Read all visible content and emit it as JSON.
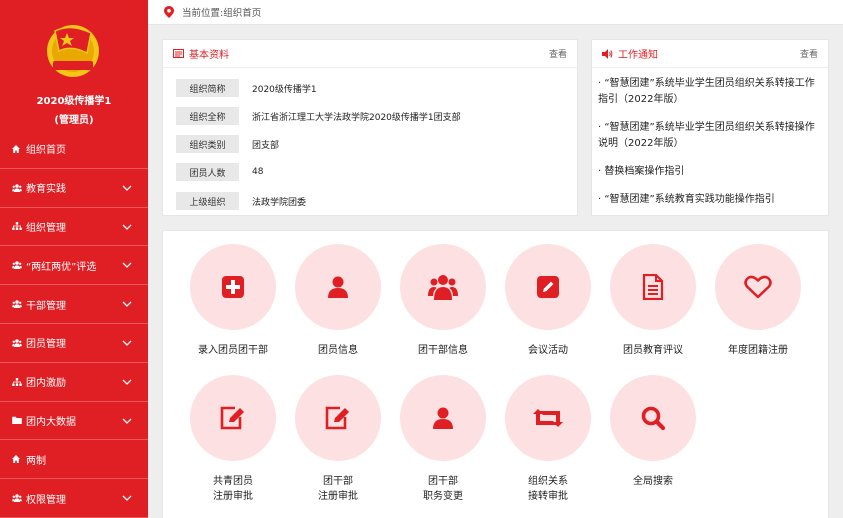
{
  "colors": {
    "brand_red": "#e01f25",
    "icon_bg": "#fde0e1"
  },
  "sidebar": {
    "org_name": "2020级传播学1",
    "role": "(管理员)",
    "items": [
      {
        "label": "组织首页",
        "icon": "home-icon",
        "has_chevron": false
      },
      {
        "label": "教育实践",
        "icon": "users-icon",
        "has_chevron": true
      },
      {
        "label": "组织管理",
        "icon": "sitemap-icon",
        "has_chevron": true
      },
      {
        "label": "“两红两优”评选",
        "icon": "users-icon",
        "has_chevron": true
      },
      {
        "label": "干部管理",
        "icon": "users-icon",
        "has_chevron": true
      },
      {
        "label": "团员管理",
        "icon": "users-icon",
        "has_chevron": true
      },
      {
        "label": "团内激励",
        "icon": "sitemap-icon",
        "has_chevron": true
      },
      {
        "label": "团内大数据",
        "icon": "folder-icon",
        "has_chevron": true
      },
      {
        "label": "两制",
        "icon": "home-icon",
        "has_chevron": false
      },
      {
        "label": "权限管理",
        "icon": "users-icon",
        "has_chevron": true
      }
    ]
  },
  "breadcrumb": {
    "text": "当前位置:组织首页"
  },
  "basic_info": {
    "title": "基本资料",
    "more": "查看",
    "rows": [
      {
        "label": "组织简称",
        "value": "2020级传播学1"
      },
      {
        "label": "组织全称",
        "value": "浙江省浙江理工大学法政学院2020级传播学1团支部"
      },
      {
        "label": "组织类别",
        "value": "团支部"
      },
      {
        "label": "团员人数",
        "value": "48"
      },
      {
        "label": "上级组织",
        "value": "法政学院团委"
      }
    ]
  },
  "notices": {
    "title": "工作通知",
    "more": "查看",
    "items": [
      "· “智慧团建”系统毕业学生团员组织关系转接工作指引（2022年版）",
      "· “智慧团建”系统毕业学生团员组织关系转接操作说明（2022年版）",
      "· 替换档案操作指引",
      "· “智慧团建”系统教育实践功能操作指引"
    ]
  },
  "actions": [
    {
      "label": "录入团员团干部",
      "icon": "plus-square-icon"
    },
    {
      "label": "团员信息",
      "icon": "user-icon"
    },
    {
      "label": "团干部信息",
      "icon": "users-icon"
    },
    {
      "label": "会议活动",
      "icon": "edit-square-icon"
    },
    {
      "label": "团员教育评议",
      "icon": "document-icon"
    },
    {
      "label": "年度团籍注册",
      "icon": "heart-icon"
    },
    {
      "label": "共青团员\n注册审批",
      "icon": "edit-icon"
    },
    {
      "label": "团干部\n注册审批",
      "icon": "edit-icon"
    },
    {
      "label": "团干部\n职务变更",
      "icon": "user-icon"
    },
    {
      "label": "组织关系\n接转审批",
      "icon": "retweet-icon"
    },
    {
      "label": "全局搜索",
      "icon": "search-icon"
    }
  ]
}
